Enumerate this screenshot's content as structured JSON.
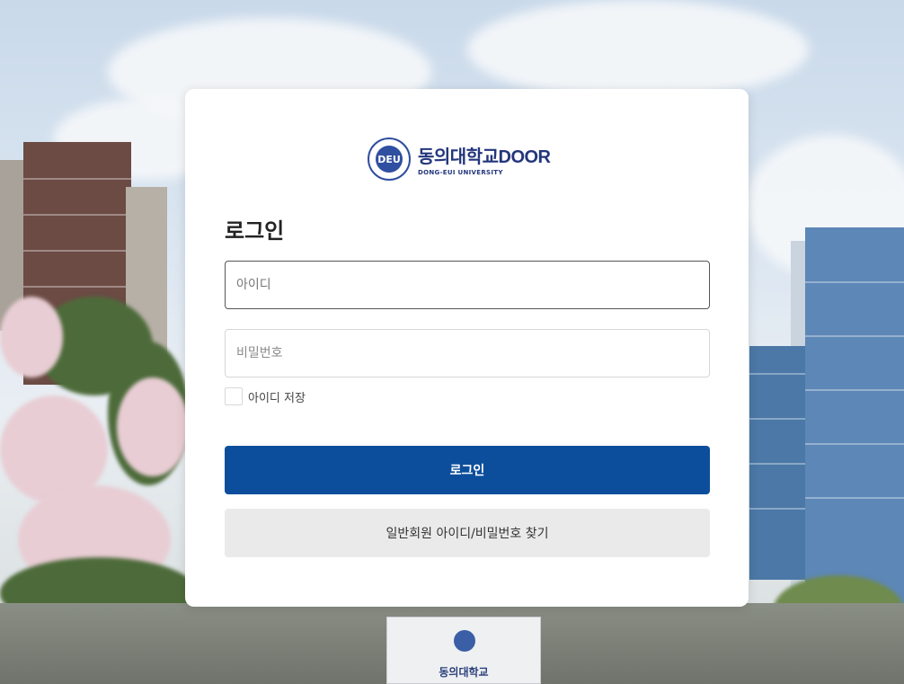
{
  "logo": {
    "title": "동의대학교",
    "brand": "DOOR",
    "subtitle": "DONG-EUI UNIVERSITY"
  },
  "login": {
    "heading": "로그인",
    "id_placeholder": "아이디",
    "password_placeholder": "비밀번호",
    "remember_label": "아이디 저장",
    "submit_label": "로그인",
    "find_account_label": "일반회원 아이디/비밀번호 찾기"
  },
  "background": {
    "gate_sign": "동의대학교"
  },
  "colors": {
    "primary": "#0d4e9c",
    "brand_navy": "#23367c",
    "secondary_button": "#eaeaea"
  }
}
